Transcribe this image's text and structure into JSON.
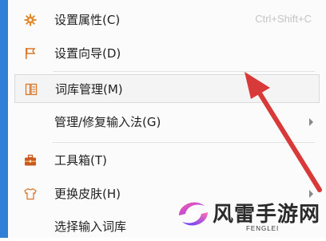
{
  "menu": {
    "items": [
      {
        "label": "设置属性(C)",
        "shortcut": "Ctrl+Shift+C",
        "icon": "gear-icon"
      },
      {
        "label": "设置向导(D)",
        "icon": "flag-icon"
      },
      {
        "label": "词库管理(M)",
        "icon": "dictionary-icon",
        "hovered": true
      },
      {
        "label": "管理/修复输入法(G)",
        "has_submenu": true
      },
      {
        "label": "工具箱(T)",
        "icon": "toolbox-icon"
      },
      {
        "label": "更换皮肤(H)",
        "icon": "shirt-icon",
        "has_submenu": true
      },
      {
        "label": "选择输入词库"
      }
    ]
  },
  "watermark": {
    "text": "风雷手游网",
    "subtext": "FENGLEI"
  },
  "colors": {
    "accent_strip": "#2f7fd6",
    "annotation_arrow": "#d83a3a",
    "icon_orange": "#e08a2e"
  }
}
